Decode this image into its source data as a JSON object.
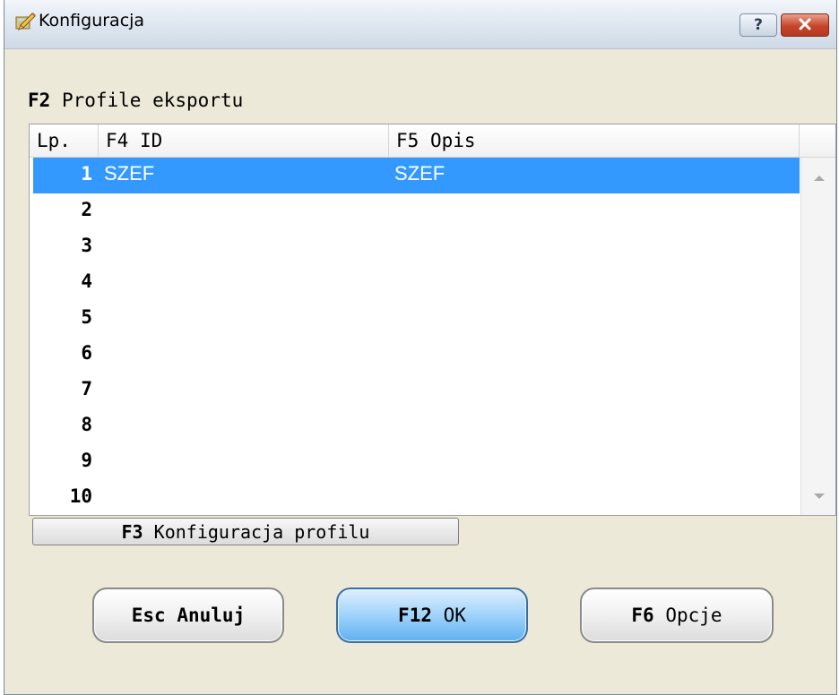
{
  "window": {
    "title": "Konfiguracja",
    "help_label": "?",
    "close_label": "x"
  },
  "section": {
    "key": "F2",
    "label": "Profile eksportu"
  },
  "table": {
    "columns": {
      "lp": "Lp.",
      "id_key": "F4",
      "id_label": "ID",
      "opis_key": "F5",
      "opis_label": "Opis"
    },
    "rows": [
      {
        "lp": "1",
        "id": "SZEF",
        "opis": "SZEF",
        "selected": true
      },
      {
        "lp": "2",
        "id": "",
        "opis": ""
      },
      {
        "lp": "3",
        "id": "",
        "opis": ""
      },
      {
        "lp": "4",
        "id": "",
        "opis": ""
      },
      {
        "lp": "5",
        "id": "",
        "opis": ""
      },
      {
        "lp": "6",
        "id": "",
        "opis": ""
      },
      {
        "lp": "7",
        "id": "",
        "opis": ""
      },
      {
        "lp": "8",
        "id": "",
        "opis": ""
      },
      {
        "lp": "9",
        "id": "",
        "opis": ""
      },
      {
        "lp": "10",
        "id": "",
        "opis": ""
      }
    ],
    "selection_color": "#3399ff"
  },
  "profile_config_button": {
    "key": "F3",
    "label": "Konfiguracja profilu"
  },
  "buttons": {
    "cancel": {
      "key": "Esc",
      "label": "Anuluj"
    },
    "ok": {
      "key": "F12",
      "label": "OK"
    },
    "options": {
      "key": "F6",
      "label": "Opcje"
    }
  },
  "icons": {
    "app": "app-pencil-icon",
    "help": "help-icon",
    "close": "close-icon",
    "scroll_up": "scroll-up-arrow-icon",
    "scroll_down": "scroll-down-arrow-icon"
  }
}
